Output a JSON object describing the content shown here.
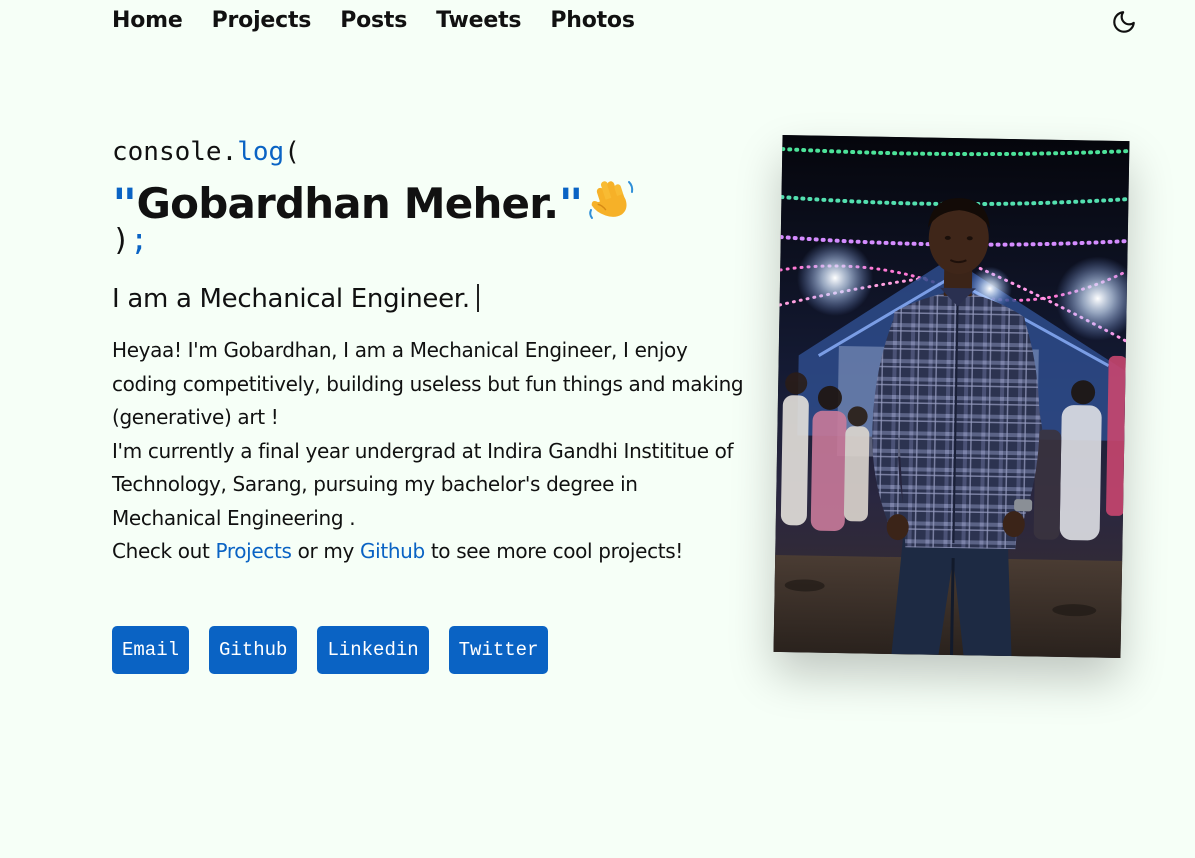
{
  "nav": {
    "items": [
      "Home",
      "Projects",
      "Posts",
      "Tweets",
      "Photos"
    ],
    "theme_toggle_icon": "moon-icon"
  },
  "hero": {
    "code_open_prefix": "console.",
    "code_open_fn": "log",
    "code_open_paren": "(",
    "quote_open": "\"",
    "name": "Gobardhan Meher.",
    "quote_close": "\"",
    "wave_emoji": "👋",
    "code_close_paren": ")",
    "code_close_semi": ";",
    "role": "I am a Mechanical Engineer."
  },
  "bio": {
    "line1": "Heyaa! I'm Gobardhan, I am a Mechanical Engineer, I enjoy coding competitively, building useless but fun things and making (generative) art !",
    "line2": "I'm currently a final year undergrad at Indira Gandhi Instititue of Technology, Sarang, pursuing my bachelor's degree in Mechanical Engineering .",
    "line3_prefix": "Check out ",
    "projects_link": "Projects",
    "line3_middle": " or my ",
    "github_link": "Github",
    "line3_suffix": " to see more cool projects!"
  },
  "buttons": {
    "email": "Email",
    "github": "Github",
    "linkedin": "Linkedin",
    "twitter": "Twitter"
  },
  "colors": {
    "background": "#f6fff7",
    "accent": "#0a63c4",
    "text": "#111111"
  }
}
